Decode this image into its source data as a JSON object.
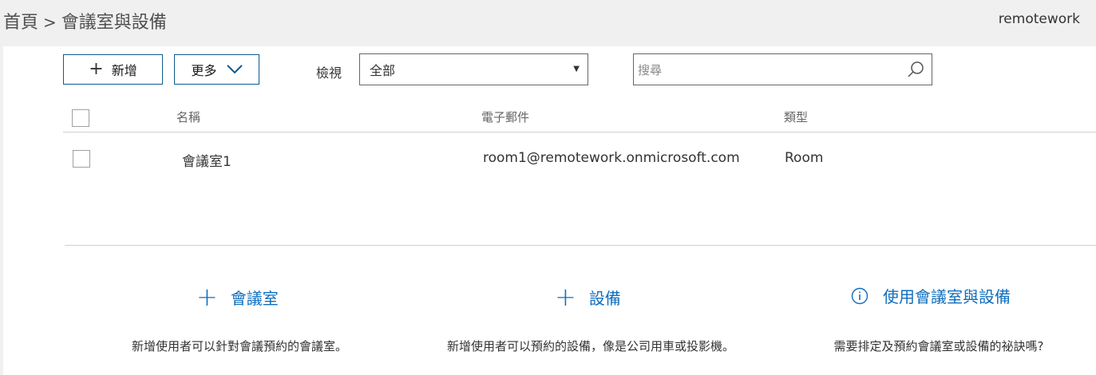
{
  "header": {
    "breadcrumb": [
      "首頁",
      "會議室與設備"
    ],
    "separator": ">",
    "tenant": "remotework"
  },
  "toolbar": {
    "new_label": "新增",
    "more_label": "更多",
    "view_label": "檢視",
    "view_selected": "全部",
    "search_placeholder": "搜尋"
  },
  "table": {
    "columns": [
      "名稱",
      "電子郵件",
      "類型"
    ],
    "rows": [
      {
        "name": "會議室1",
        "email": "room1@remotework.onmicrosoft.com",
        "type": "Room"
      }
    ]
  },
  "actions": [
    {
      "label": "會議室",
      "icon": "plus-icon",
      "description": "新增使用者可以針對會議預約的會議室。"
    },
    {
      "label": "設備",
      "icon": "plus-icon",
      "description": "新增使用者可以預約的設備，像是公司用車或投影機。"
    },
    {
      "label": "使用會議室與設備",
      "icon": "info-icon",
      "description": "需要排定及預約會議室或設備的祕訣嗎?"
    }
  ],
  "colors": {
    "accent": "#106ebe",
    "button_border": "#0e5a8a",
    "header_bg": "#f0f0f0"
  }
}
